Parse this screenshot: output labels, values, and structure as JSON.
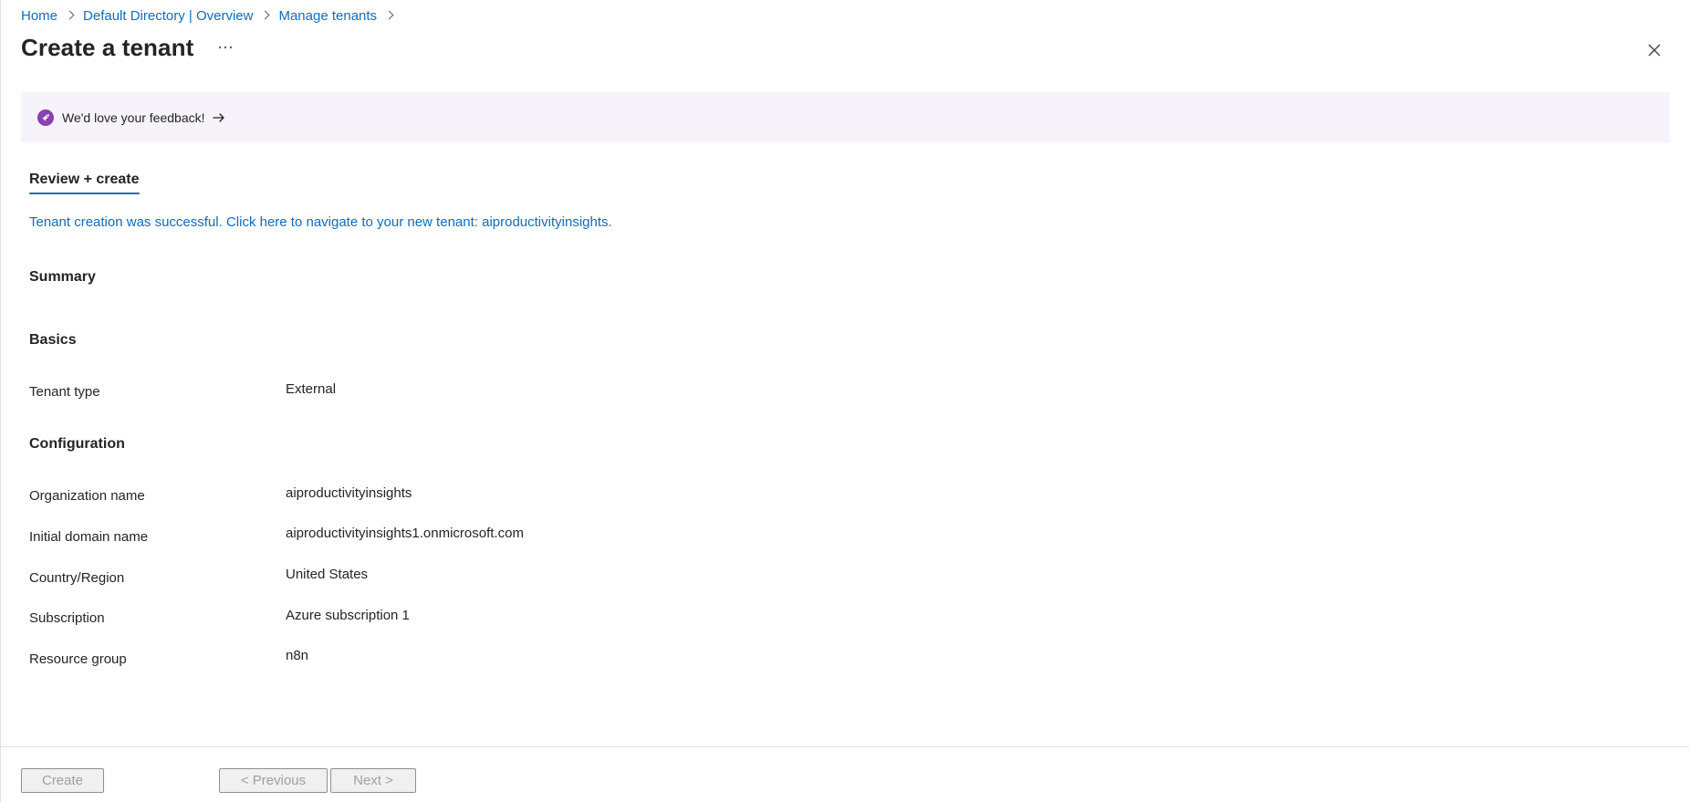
{
  "breadcrumb": {
    "items": [
      "Home",
      "Default Directory | Overview",
      "Manage tenants"
    ]
  },
  "header": {
    "title": "Create a tenant",
    "more_label": "…"
  },
  "feedback": {
    "text": "We'd love your feedback!",
    "icon": "rocket-icon",
    "arrow": "arrow-right-icon"
  },
  "tabs": {
    "active": "Review + create"
  },
  "status": {
    "success_message": "Tenant creation was successful. Click here to navigate to your new tenant: aiproductivityinsights."
  },
  "summary": {
    "heading": "Summary",
    "basics": {
      "heading": "Basics",
      "rows": [
        {
          "label": "Tenant type",
          "value": "External"
        }
      ]
    },
    "configuration": {
      "heading": "Configuration",
      "rows": [
        {
          "label": "Organization name",
          "value": "aiproductivityinsights"
        },
        {
          "label": "Initial domain name",
          "value": "aiproductivityinsights1.onmicrosoft.com"
        },
        {
          "label": "Country/Region",
          "value": "United States"
        },
        {
          "label": "Subscription",
          "value": "Azure subscription 1"
        },
        {
          "label": "Resource group",
          "value": "n8n"
        }
      ]
    }
  },
  "footer": {
    "create_label": "Create",
    "previous_label": "< Previous",
    "next_label": "Next >"
  },
  "colors": {
    "link": "#0f6cbd",
    "banner_bg": "#f7f3fa",
    "feedback_icon": "#8a3fb3",
    "tab_underline": "#0f6cbd"
  }
}
